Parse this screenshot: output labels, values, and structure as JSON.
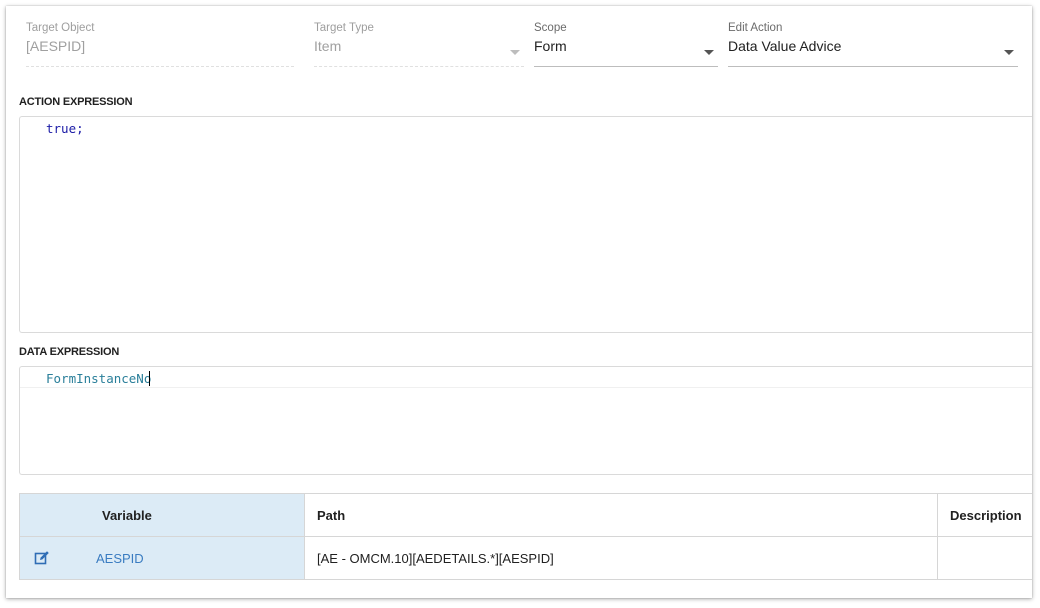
{
  "fields": {
    "target_object": {
      "label": "Target Object",
      "value": "[AESPID]"
    },
    "target_type": {
      "label": "Target Type",
      "value": "Item"
    },
    "scope": {
      "label": "Scope",
      "value": "Form"
    },
    "edit_action": {
      "label": "Edit Action",
      "value": "Data Value Advice"
    }
  },
  "action_expression": {
    "label": "ACTION EXPRESSION",
    "code": "true;"
  },
  "data_expression": {
    "label": "DATA EXPRESSION",
    "code": "FormInstanceNo"
  },
  "variables_table": {
    "columns": [
      "Variable",
      "Path",
      "Description"
    ],
    "rows": [
      {
        "variable": "AESPID",
        "path": "[AE - OMCM.10][AEDETAILS.*][AESPID]",
        "description": ""
      }
    ]
  },
  "colors": {
    "sorted_column_bg": "#dcebf6",
    "link": "#3a7cc1",
    "edit_icon": "#2f6db5"
  },
  "icons": {
    "row_edit": "edit-icon"
  }
}
